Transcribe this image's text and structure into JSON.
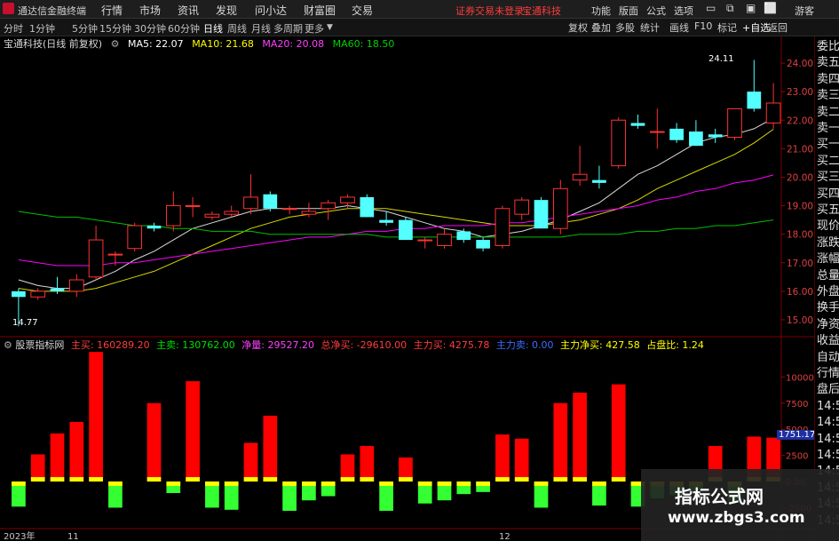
{
  "app": {
    "title": "通达信金融终端",
    "menus": [
      "行情",
      "市场",
      "资讯",
      "发现",
      "问小达",
      "财富圈",
      "交易"
    ],
    "notice": "证券交易未登录",
    "stock_title": "宝通科技",
    "right_menus": [
      "功能",
      "版面",
      "公式",
      "选项",
      "游客"
    ]
  },
  "periods": [
    "分时",
    "1分钟",
    "5分钟",
    "15分钟",
    "30分钟",
    "60分钟",
    "日线",
    "周线",
    "月线",
    "多周期",
    "更多"
  ],
  "active_period": "日线",
  "toolbar_right": [
    "复权",
    "叠加",
    "多股",
    "统计",
    "画线",
    "F10",
    "标记",
    "+自选",
    "返回"
  ],
  "ma_header": {
    "label": "宝通科技(日线 前复权)",
    "ma5": "MA5: 22.07",
    "ma10": "MA10: 21.68",
    "ma20": "MA20: 20.08",
    "ma60": "MA60: 18.50"
  },
  "price_axis": [
    "24.00",
    "23.00",
    "22.00",
    "21.00",
    "20.00",
    "19.00",
    "18.00",
    "17.00",
    "16.00",
    "15.00"
  ],
  "annotations": {
    "high": "24.11",
    "low": "14.77"
  },
  "indicator_header": {
    "name": "股票指标网",
    "buy": "主买: 160289.20",
    "sell": "主卖: 130762.00",
    "net": "净量: 29527.20",
    "total_net": "总净买: -29610.00",
    "main_buy": "主力买: 4275.78",
    "main_sell": "主力卖: 0.00",
    "main_net": "主力净买: 427.58",
    "ratio": "占盘比: 1.24"
  },
  "vol_axis": [
    "10000",
    "7500",
    "5000",
    "2500",
    "0.00",
    "-2500"
  ],
  "vol_current": "1751.17",
  "date_labels": [
    "2023年",
    "11",
    "12"
  ],
  "side_panel": [
    "委比",
    "卖五",
    "卖四",
    "卖三",
    "卖二",
    "卖一",
    "买一",
    "买二",
    "买三",
    "买四",
    "买五",
    "现价",
    "涨跌",
    "涨幅",
    "总量",
    "外盘",
    "换手",
    "净资",
    "收益",
    "自动",
    "行情",
    "盘后",
    "14:50",
    "14:50",
    "14:50",
    "14:5",
    "14:5",
    "14:5",
    "14:5",
    "14:5"
  ],
  "watermark": {
    "line1": "指标公式网",
    "line2": "www.zbgs3.com"
  },
  "colors": {
    "up": "#ff3232",
    "down": "#54ffff",
    "ma5": "#ffffff",
    "ma10": "#ffff00",
    "ma20": "#ff00ff",
    "ma60": "#00c000",
    "bar_up": "#ff0000",
    "bar_down": "#33ff33",
    "cap": "#ffff00"
  },
  "chart_data": {
    "type": "candlestick",
    "price_range": [
      14.5,
      24.5
    ],
    "candles": [
      {
        "o": 16.0,
        "h": 16.1,
        "l": 14.77,
        "c": 15.8
      },
      {
        "o": 15.8,
        "h": 16.1,
        "l": 15.7,
        "c": 16.0
      },
      {
        "o": 16.1,
        "h": 16.5,
        "l": 15.9,
        "c": 16.0
      },
      {
        "o": 16.0,
        "h": 16.6,
        "l": 15.8,
        "c": 16.4
      },
      {
        "o": 16.5,
        "h": 18.3,
        "l": 16.4,
        "c": 17.8
      },
      {
        "o": 17.3,
        "h": 17.4,
        "l": 16.9,
        "c": 17.3
      },
      {
        "o": 17.5,
        "h": 18.4,
        "l": 17.4,
        "c": 18.3
      },
      {
        "o": 18.3,
        "h": 18.4,
        "l": 18.1,
        "c": 18.2
      },
      {
        "o": 18.3,
        "h": 19.5,
        "l": 18.1,
        "c": 19.0
      },
      {
        "o": 19.0,
        "h": 19.3,
        "l": 18.6,
        "c": 19.0
      },
      {
        "o": 18.6,
        "h": 18.8,
        "l": 18.5,
        "c": 18.7
      },
      {
        "o": 18.7,
        "h": 19.0,
        "l": 18.6,
        "c": 18.8
      },
      {
        "o": 18.9,
        "h": 20.1,
        "l": 18.7,
        "c": 19.3
      },
      {
        "o": 19.4,
        "h": 19.5,
        "l": 18.8,
        "c": 18.9
      },
      {
        "o": 18.9,
        "h": 19.0,
        "l": 18.7,
        "c": 18.9
      },
      {
        "o": 18.7,
        "h": 19.1,
        "l": 18.6,
        "c": 18.8
      },
      {
        "o": 18.9,
        "h": 19.2,
        "l": 18.5,
        "c": 19.1
      },
      {
        "o": 19.1,
        "h": 19.4,
        "l": 18.9,
        "c": 19.3
      },
      {
        "o": 19.3,
        "h": 19.4,
        "l": 18.6,
        "c": 18.6
      },
      {
        "o": 18.5,
        "h": 18.8,
        "l": 18.3,
        "c": 18.4
      },
      {
        "o": 18.5,
        "h": 18.6,
        "l": 17.8,
        "c": 17.8
      },
      {
        "o": 17.8,
        "h": 17.9,
        "l": 17.5,
        "c": 17.8
      },
      {
        "o": 17.6,
        "h": 18.2,
        "l": 17.5,
        "c": 18.0
      },
      {
        "o": 18.1,
        "h": 18.2,
        "l": 17.7,
        "c": 17.8
      },
      {
        "o": 17.8,
        "h": 17.9,
        "l": 17.4,
        "c": 17.5
      },
      {
        "o": 17.6,
        "h": 19.0,
        "l": 17.5,
        "c": 18.9
      },
      {
        "o": 18.7,
        "h": 19.3,
        "l": 18.5,
        "c": 19.2
      },
      {
        "o": 19.2,
        "h": 19.3,
        "l": 18.2,
        "c": 18.2
      },
      {
        "o": 18.2,
        "h": 19.9,
        "l": 18.0,
        "c": 19.6
      },
      {
        "o": 19.9,
        "h": 21.1,
        "l": 19.7,
        "c": 20.1
      },
      {
        "o": 19.9,
        "h": 20.4,
        "l": 19.6,
        "c": 19.8
      },
      {
        "o": 20.4,
        "h": 22.1,
        "l": 20.3,
        "c": 22.0
      },
      {
        "o": 21.9,
        "h": 22.2,
        "l": 21.7,
        "c": 21.8
      },
      {
        "o": 21.6,
        "h": 22.4,
        "l": 21.0,
        "c": 21.6
      },
      {
        "o": 21.7,
        "h": 21.9,
        "l": 21.2,
        "c": 21.3
      },
      {
        "o": 21.6,
        "h": 22.0,
        "l": 21.1,
        "c": 21.1
      },
      {
        "o": 21.5,
        "h": 21.7,
        "l": 21.2,
        "c": 21.4
      },
      {
        "o": 21.4,
        "h": 22.4,
        "l": 21.3,
        "c": 22.4
      },
      {
        "o": 23.0,
        "h": 24.11,
        "l": 22.3,
        "c": 22.4
      },
      {
        "o": 21.9,
        "h": 23.3,
        "l": 21.7,
        "c": 22.6
      }
    ],
    "ma_series": [
      {
        "name": "MA5",
        "values": [
          16.4,
          16.2,
          16.1,
          16.1,
          16.4,
          16.7,
          17.1,
          17.4,
          17.8,
          18.2,
          18.4,
          18.6,
          18.8,
          18.9,
          18.9,
          18.9,
          18.9,
          19.0,
          18.9,
          18.8,
          18.6,
          18.4,
          18.2,
          18.1,
          17.9,
          18.0,
          18.1,
          18.3,
          18.5,
          18.8,
          19.1,
          19.6,
          20.1,
          20.4,
          20.8,
          21.2,
          21.4,
          21.5,
          21.7,
          22.07
        ]
      },
      {
        "name": "MA10",
        "values": [
          16.1,
          16.0,
          16.0,
          16.0,
          16.1,
          16.3,
          16.5,
          16.7,
          17.0,
          17.3,
          17.6,
          17.9,
          18.2,
          18.4,
          18.6,
          18.7,
          18.8,
          18.9,
          18.9,
          18.9,
          18.8,
          18.7,
          18.6,
          18.5,
          18.4,
          18.3,
          18.3,
          18.3,
          18.4,
          18.5,
          18.7,
          18.9,
          19.2,
          19.6,
          19.9,
          20.2,
          20.5,
          20.8,
          21.2,
          21.68
        ]
      },
      {
        "name": "MA20",
        "values": [
          17.1,
          17.0,
          16.9,
          16.9,
          16.9,
          17.0,
          17.0,
          17.1,
          17.2,
          17.3,
          17.4,
          17.5,
          17.6,
          17.7,
          17.8,
          17.9,
          17.9,
          18.0,
          18.1,
          18.1,
          18.2,
          18.2,
          18.3,
          18.3,
          18.3,
          18.4,
          18.4,
          18.5,
          18.6,
          18.7,
          18.8,
          18.9,
          19.0,
          19.2,
          19.3,
          19.5,
          19.6,
          19.8,
          19.9,
          20.08
        ]
      },
      {
        "name": "MA60",
        "values": [
          18.8,
          18.7,
          18.6,
          18.6,
          18.5,
          18.4,
          18.3,
          18.3,
          18.2,
          18.2,
          18.1,
          18.1,
          18.1,
          18.0,
          18.0,
          18.0,
          18.0,
          18.0,
          18.0,
          17.9,
          17.9,
          17.9,
          17.9,
          17.9,
          17.9,
          17.9,
          17.9,
          17.9,
          17.9,
          18.0,
          18.0,
          18.0,
          18.1,
          18.1,
          18.2,
          18.2,
          18.3,
          18.3,
          18.4,
          18.5
        ]
      }
    ],
    "volume": {
      "range": [
        -4500,
        12500
      ],
      "up": [
        0,
        2600,
        4600,
        5700,
        12400,
        0,
        0,
        7500,
        0,
        9600,
        0,
        0,
        3700,
        6300,
        0,
        0,
        0,
        2600,
        3400,
        0,
        2300,
        0,
        0,
        0,
        0,
        4500,
        4100,
        0,
        7500,
        8500,
        0,
        9300,
        0,
        0,
        0,
        0,
        3400,
        0,
        4300,
        4200
      ],
      "down": [
        2400,
        0,
        0,
        0,
        0,
        2500,
        0,
        0,
        1100,
        0,
        2500,
        2700,
        0,
        0,
        2800,
        1800,
        1400,
        0,
        0,
        2800,
        0,
        2100,
        1800,
        1200,
        1000,
        0,
        0,
        2500,
        0,
        0,
        2300,
        0,
        2400,
        1600,
        1300,
        1000,
        0,
        1900,
        0,
        0
      ]
    }
  }
}
